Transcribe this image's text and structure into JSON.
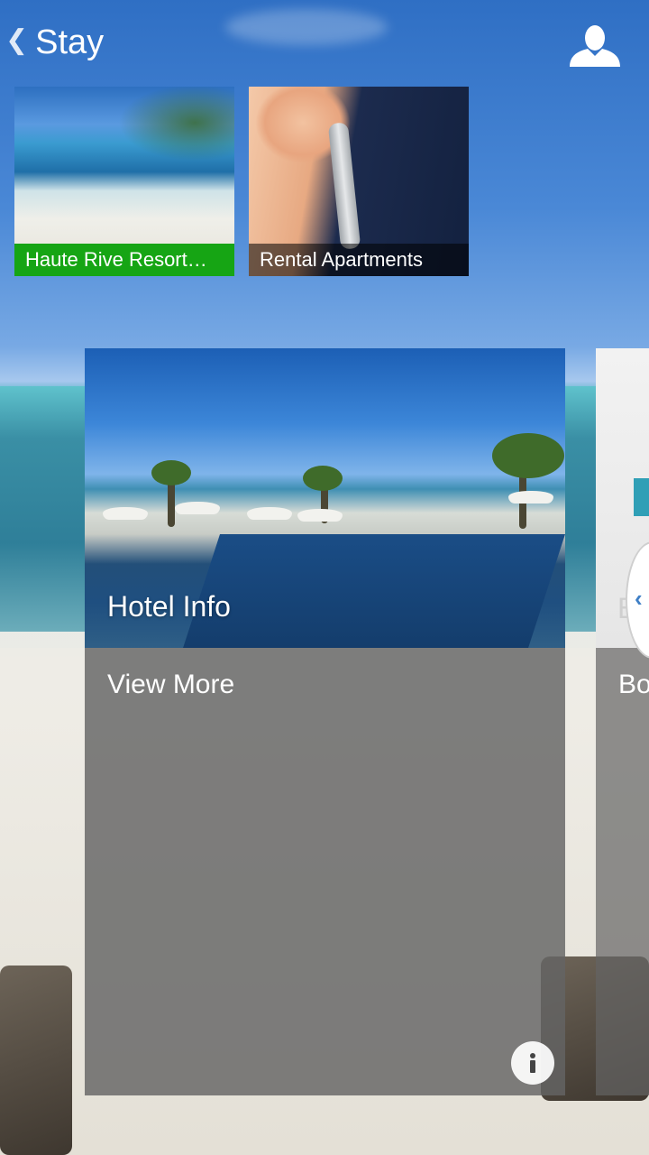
{
  "header": {
    "back_chevron": "❮",
    "title": "Stay",
    "profile_icon": "user-silhouette-icon"
  },
  "tiles": [
    {
      "label": "Haute Rive Resort…",
      "label_bg": "#16a514",
      "selected": true
    },
    {
      "label": "Rental Apartments",
      "label_bg": "rgba(0,0,0,0.55)",
      "selected": false
    }
  ],
  "cards": [
    {
      "title": "Hotel Info",
      "link": "View More",
      "info_icon": "info-icon"
    },
    {
      "title": "B",
      "link": "Bo"
    }
  ],
  "side_handle": {
    "icon": "chevron-left-icon",
    "glyph": "‹"
  },
  "colors": {
    "accent_green": "#16a514",
    "accent_blue": "#3f7fc6"
  }
}
